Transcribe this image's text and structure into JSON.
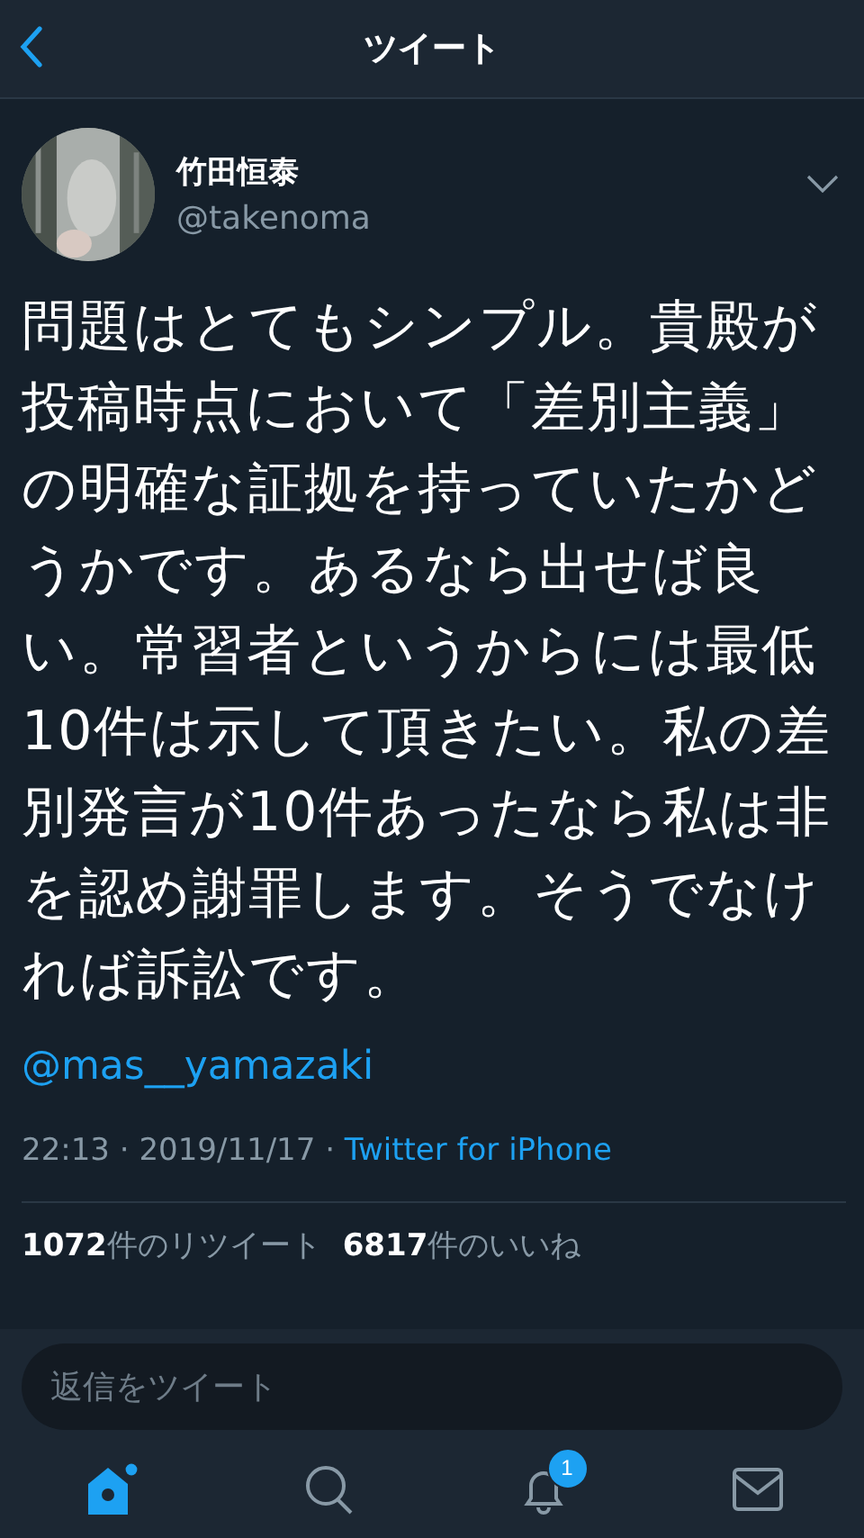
{
  "header": {
    "title": "ツイート"
  },
  "tweet": {
    "name": "竹田恒泰",
    "handle": "@takenoma",
    "text": "問題はとてもシンプル。貴殿が投稿時点において「差別主義」の明確な証拠を持っていたかどうかです。あるなら出せば良い。常習者というからには最低10件は示して頂きたい。私の差別発言が10件あったなら私は非を認め謝罪します。そうでなければ訴訟です。",
    "mention": "@mas__yamazaki",
    "timestamp": "22:13 · 2019/11/17 · ",
    "source": "Twitter for iPhone"
  },
  "stats": [
    "**1072**件のリツイート",
    "**6817**件のいいね"
  ],
  "reply": {
    "placeholder": "返信をツイート"
  },
  "tabs": [
    {
      "kind": "home",
      "selected": true
    },
    {
      "kind": "search",
      "selected": false
    },
    {
      "kind": "notifications",
      "selected": false,
      "badge": "1"
    },
    {
      "kind": "messages",
      "selected": false
    }
  ]
}
